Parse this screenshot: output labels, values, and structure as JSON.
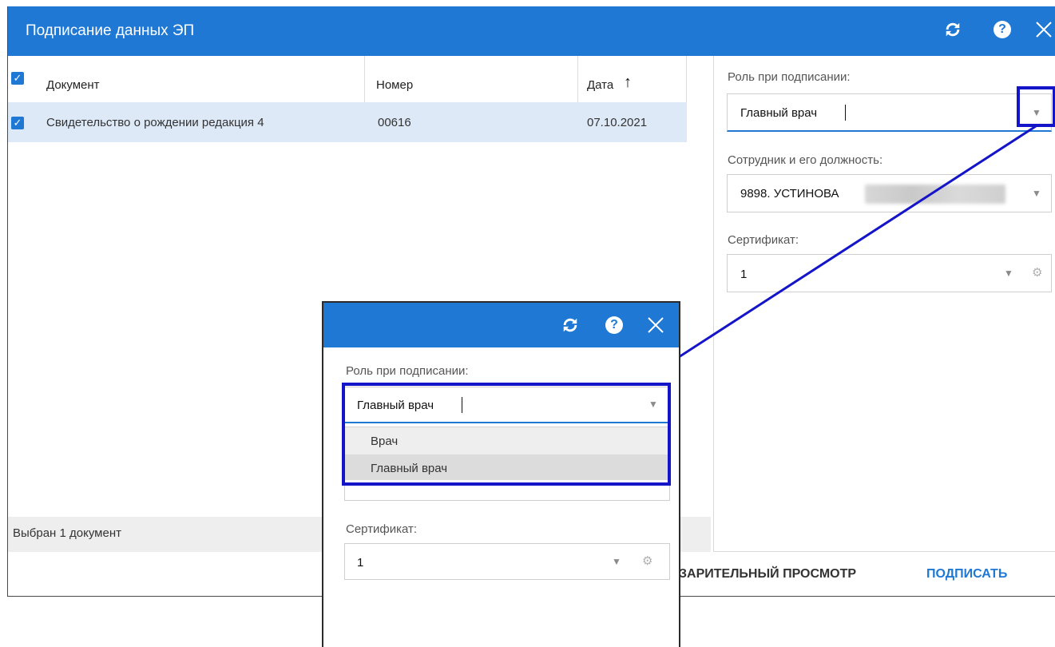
{
  "dialog": {
    "title": "Подписание данных ЭП",
    "refresh_icon": "refresh-icon",
    "help_icon": "help-icon",
    "close_icon": "close-icon"
  },
  "table": {
    "columns": [
      "Документ",
      "Номер",
      "Дата"
    ],
    "sort_indicator": "↑",
    "rows": [
      {
        "document": "Свидетельство о рождении редакция 4",
        "number": "00616",
        "date": "07.10.2021",
        "checked": true
      }
    ]
  },
  "status": {
    "selected_text": "Выбран 1 документ"
  },
  "panel": {
    "role_label": "Роль при подписании:",
    "role_value": "Главный врач",
    "employee_label": "Сотрудник и его должность:",
    "employee_value": "9898. УСТИНОВА",
    "certificate_label": "Сертификат:",
    "certificate_value": "1"
  },
  "footer": {
    "preview_label": "ЗАРИТЕЛЬНЫЙ ПРОСМОТР",
    "sign_label": "ПОДПИСАТЬ"
  },
  "inset": {
    "role_label": "Роль при подписании:",
    "role_value": "Главный врач",
    "options": [
      "Врач",
      "Главный врач"
    ],
    "certificate_label": "Сертификат:",
    "certificate_value": "1"
  },
  "colors": {
    "header_blue": "#1e78d4",
    "highlight": "#1414c8",
    "selected_row": "#dde9f7"
  }
}
